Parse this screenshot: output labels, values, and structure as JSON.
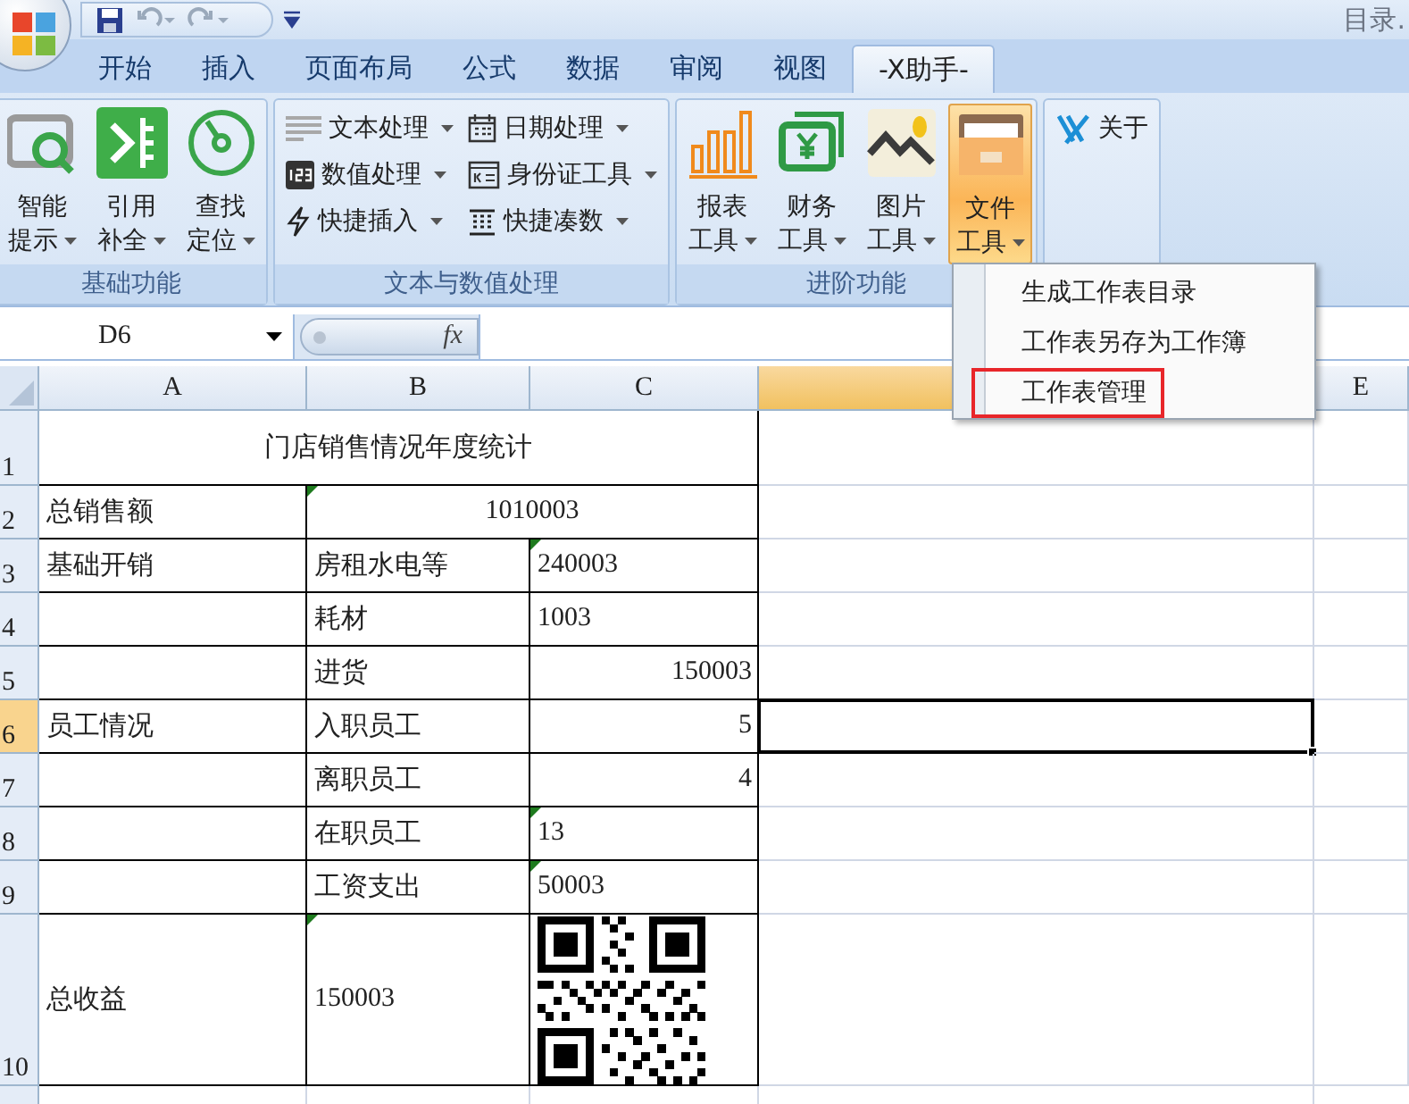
{
  "title_bar": {
    "title": "目录."
  },
  "quick_access": [
    {
      "disabled": false
    },
    {
      "disabled": true
    },
    {
      "disabled": true
    }
  ],
  "tabs": [
    {
      "label": "开始",
      "selected": false
    },
    {
      "label": "插入",
      "selected": false
    },
    {
      "label": "页面布局",
      "selected": false
    },
    {
      "label": "公式",
      "selected": false
    },
    {
      "label": "数据",
      "selected": false
    },
    {
      "label": "审阅",
      "selected": false
    },
    {
      "label": "视图",
      "selected": false
    },
    {
      "label": "-X助手-",
      "selected": true
    }
  ],
  "ribbon": {
    "groups": [
      {
        "title": "基础功能",
        "kind": "large",
        "buttons": [
          {
            "lines": [
              "智能",
              "提示"
            ],
            "dropdown": true,
            "active": false
          },
          {
            "lines": [
              "引用",
              "补全"
            ],
            "dropdown": true,
            "active": false
          },
          {
            "lines": [
              "查找",
              "定位"
            ],
            "dropdown": true,
            "active": false
          }
        ]
      },
      {
        "title": "文本与数值处理",
        "kind": "small",
        "buttons": [
          {
            "label": "文本处理",
            "dropdown": true
          },
          {
            "label": "数值处理",
            "dropdown": true
          },
          {
            "label": "快捷插入",
            "dropdown": true
          },
          {
            "label": "日期处理",
            "dropdown": true
          },
          {
            "label": "身份证工具",
            "dropdown": true
          },
          {
            "label": "快捷凑数",
            "dropdown": true
          }
        ]
      },
      {
        "title": "进阶功能",
        "kind": "large",
        "buttons": [
          {
            "lines": [
              "报表",
              "工具"
            ],
            "dropdown": true,
            "active": false
          },
          {
            "lines": [
              "财务",
              "工具"
            ],
            "dropdown": true,
            "active": false
          },
          {
            "lines": [
              "图片",
              "工具"
            ],
            "dropdown": true,
            "active": false
          },
          {
            "lines": [
              "文件",
              "工具"
            ],
            "dropdown": true,
            "active": true
          }
        ]
      },
      {
        "kind": "small",
        "buttons": [
          {
            "label": "关于",
            "dropdown": false
          }
        ]
      }
    ]
  },
  "formula_bar": {
    "name_box": "D6",
    "fx": "fx"
  },
  "sheet": {
    "columns": [
      {
        "label": "A",
        "selected": false
      },
      {
        "label": "B",
        "selected": false
      },
      {
        "label": "C",
        "selected": false
      },
      {
        "selected": true
      },
      {
        "label": "E",
        "selected": false
      }
    ],
    "rows": [
      {
        "number": "1",
        "selected": false,
        "A_to_C": {
          "kind": "title",
          "text": "门店销售情况年度统计",
          "flagged": false
        }
      },
      {
        "number": "2",
        "selected": false,
        "A": {
          "kind": "text",
          "text": "总销售额",
          "flagged": false
        },
        "B_to_C": {
          "kind": "merged",
          "text": "1010003",
          "flagged": true
        }
      },
      {
        "number": "3",
        "selected": false,
        "A": {
          "kind": "text",
          "text": "基础开销",
          "flagged": false
        },
        "B": {
          "kind": "text",
          "text": "房租水电等",
          "flagged": false
        },
        "C": {
          "kind": "text",
          "text": "240003",
          "flagged": true
        }
      },
      {
        "number": "4",
        "selected": false,
        "B": {
          "kind": "text",
          "text": "耗材",
          "flagged": false
        },
        "C": {
          "kind": "text",
          "text": "1003",
          "flagged": false
        }
      },
      {
        "number": "5",
        "selected": false,
        "B": {
          "kind": "text",
          "text": "进货",
          "flagged": false
        },
        "C": {
          "kind": "number",
          "text": "150003",
          "flagged": false
        }
      },
      {
        "number": "6",
        "selected": true,
        "A": {
          "kind": "text",
          "text": "员工情况",
          "flagged": false
        },
        "B": {
          "kind": "text",
          "text": "入职员工",
          "flagged": false
        },
        "C": {
          "kind": "number",
          "text": "5",
          "flagged": false
        }
      },
      {
        "number": "7",
        "selected": false,
        "B": {
          "kind": "text",
          "text": "离职员工",
          "flagged": false
        },
        "C": {
          "kind": "number",
          "text": "4",
          "flagged": false
        }
      },
      {
        "number": "8",
        "selected": false,
        "B": {
          "kind": "text",
          "text": "在职员工",
          "flagged": false
        },
        "C": {
          "kind": "text",
          "text": "13",
          "flagged": true
        }
      },
      {
        "number": "9",
        "selected": false,
        "B": {
          "kind": "text",
          "text": "工资支出",
          "flagged": false
        },
        "C": {
          "kind": "text",
          "text": "50003",
          "flagged": true
        }
      },
      {
        "number": "10",
        "selected": false,
        "A": {
          "kind": "text",
          "text": "总收益",
          "flagged": false
        },
        "B": {
          "kind": "text",
          "text": "150003",
          "flagged": true
        },
        "C": {
          "kind": "qr",
          "flagged": false
        }
      }
    ]
  },
  "dropdown_menu": {
    "items": [
      {
        "label": "生成工作表目录",
        "selected": false
      },
      {
        "label": "工作表另存为工作簿",
        "selected": false
      },
      {
        "label": "工作表管理",
        "selected": true
      }
    ]
  }
}
